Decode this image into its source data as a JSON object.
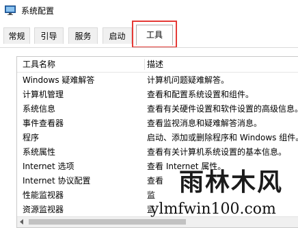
{
  "window": {
    "title": "系统配置",
    "icon": "system-config-icon"
  },
  "tabs": [
    {
      "label": "常规"
    },
    {
      "label": "引导"
    },
    {
      "label": "服务"
    },
    {
      "label": "启动"
    },
    {
      "label": "工具",
      "selected": true
    }
  ],
  "highlight_color": "#e53935",
  "table": {
    "headers": [
      "工具名称",
      "描述"
    ],
    "rows": [
      {
        "name": "Windows 疑难解答",
        "desc": "计算机问题疑难解答。"
      },
      {
        "name": "计算机管理",
        "desc": "查看和配置系统设置和组件。"
      },
      {
        "name": "系统信息",
        "desc": "查看有关硬件设置和软件设置的高级信息。"
      },
      {
        "name": "事件查看器",
        "desc": "查看监视消息和疑难解答消息。"
      },
      {
        "name": "程序",
        "desc": "启动、添加或删除程序和 Windows 组件。"
      },
      {
        "name": "系统属性",
        "desc": "查看有关计算机系统设置的基本信息。"
      },
      {
        "name": "Internet 选项",
        "desc": "查看 Internet 属性。"
      },
      {
        "name": "Internet 协议配置",
        "desc": "查看"
      },
      {
        "name": "性能监视器",
        "desc": "监"
      },
      {
        "name": "资源监视器",
        "desc": "监"
      }
    ]
  },
  "watermark": {
    "logo": "雨林木风",
    "url": "ylmfwin100.com"
  }
}
